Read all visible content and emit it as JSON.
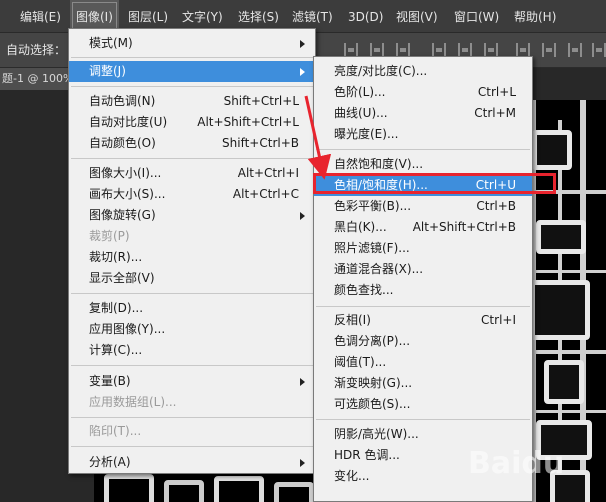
{
  "menubar": {
    "items": [
      {
        "label": "编辑(E)"
      },
      {
        "label": "图像(I)"
      },
      {
        "label": "图层(L)"
      },
      {
        "label": "文字(Y)"
      },
      {
        "label": "选择(S)"
      },
      {
        "label": "滤镜(T)"
      },
      {
        "label": "3D(D)"
      },
      {
        "label": "视图(V)"
      },
      {
        "label": "窗口(W)"
      },
      {
        "label": "帮助(H)"
      }
    ],
    "active_index": 1
  },
  "options_bar": {
    "auto_select_label": "自动选择："
  },
  "document_tab": {
    "title": "题-1 @ 100%"
  },
  "image_menu": {
    "items": [
      {
        "label": "模式(M)",
        "shortcut": "",
        "submenu": true
      },
      {
        "label": "调整(J)",
        "shortcut": "",
        "submenu": true,
        "highlighted": true
      },
      {
        "label": "自动色调(N)",
        "shortcut": "Shift+Ctrl+L"
      },
      {
        "label": "自动对比度(U)",
        "shortcut": "Alt+Shift+Ctrl+L"
      },
      {
        "label": "自动颜色(O)",
        "shortcut": "Shift+Ctrl+B"
      },
      {
        "label": "图像大小(I)...",
        "shortcut": "Alt+Ctrl+I"
      },
      {
        "label": "画布大小(S)...",
        "shortcut": "Alt+Ctrl+C"
      },
      {
        "label": "图像旋转(G)",
        "shortcut": "",
        "submenu": true
      },
      {
        "label": "裁剪(P)",
        "shortcut": "",
        "disabled": true
      },
      {
        "label": "裁切(R)...",
        "shortcut": ""
      },
      {
        "label": "显示全部(V)",
        "shortcut": ""
      },
      {
        "label": "复制(D)...",
        "shortcut": ""
      },
      {
        "label": "应用图像(Y)...",
        "shortcut": ""
      },
      {
        "label": "计算(C)...",
        "shortcut": ""
      },
      {
        "label": "变量(B)",
        "shortcut": "",
        "submenu": true
      },
      {
        "label": "应用数据组(L)...",
        "shortcut": "",
        "disabled": true
      },
      {
        "label": "陷印(T)...",
        "shortcut": "",
        "disabled": true
      },
      {
        "label": "分析(A)",
        "shortcut": "",
        "submenu": true
      }
    ]
  },
  "adjust_menu": {
    "items": [
      {
        "label": "亮度/对比度(C)...",
        "shortcut": ""
      },
      {
        "label": "色阶(L)...",
        "shortcut": "Ctrl+L"
      },
      {
        "label": "曲线(U)...",
        "shortcut": "Ctrl+M"
      },
      {
        "label": "曝光度(E)...",
        "shortcut": ""
      },
      {
        "label": "自然饱和度(V)...",
        "shortcut": ""
      },
      {
        "label": "色相/饱和度(H)...",
        "shortcut": "Ctrl+U",
        "highlighted": true
      },
      {
        "label": "色彩平衡(B)...",
        "shortcut": "Ctrl+B"
      },
      {
        "label": "黑白(K)...",
        "shortcut": "Alt+Shift+Ctrl+B"
      },
      {
        "label": "照片滤镜(F)...",
        "shortcut": ""
      },
      {
        "label": "通道混合器(X)...",
        "shortcut": ""
      },
      {
        "label": "颜色查找...",
        "shortcut": ""
      },
      {
        "label": "反相(I)",
        "shortcut": "Ctrl+I"
      },
      {
        "label": "色调分离(P)...",
        "shortcut": ""
      },
      {
        "label": "阈值(T)...",
        "shortcut": ""
      },
      {
        "label": "渐变映射(G)...",
        "shortcut": ""
      },
      {
        "label": "可选颜色(S)...",
        "shortcut": ""
      },
      {
        "label": "阴影/高光(W)...",
        "shortcut": ""
      },
      {
        "label": "HDR 色调...",
        "shortcut": ""
      },
      {
        "label": "变化...",
        "shortcut": ""
      }
    ]
  },
  "watermark": {
    "text": "Baidu"
  },
  "colors": {
    "highlight": "#3e8edc",
    "annotation": "#e8242e"
  }
}
